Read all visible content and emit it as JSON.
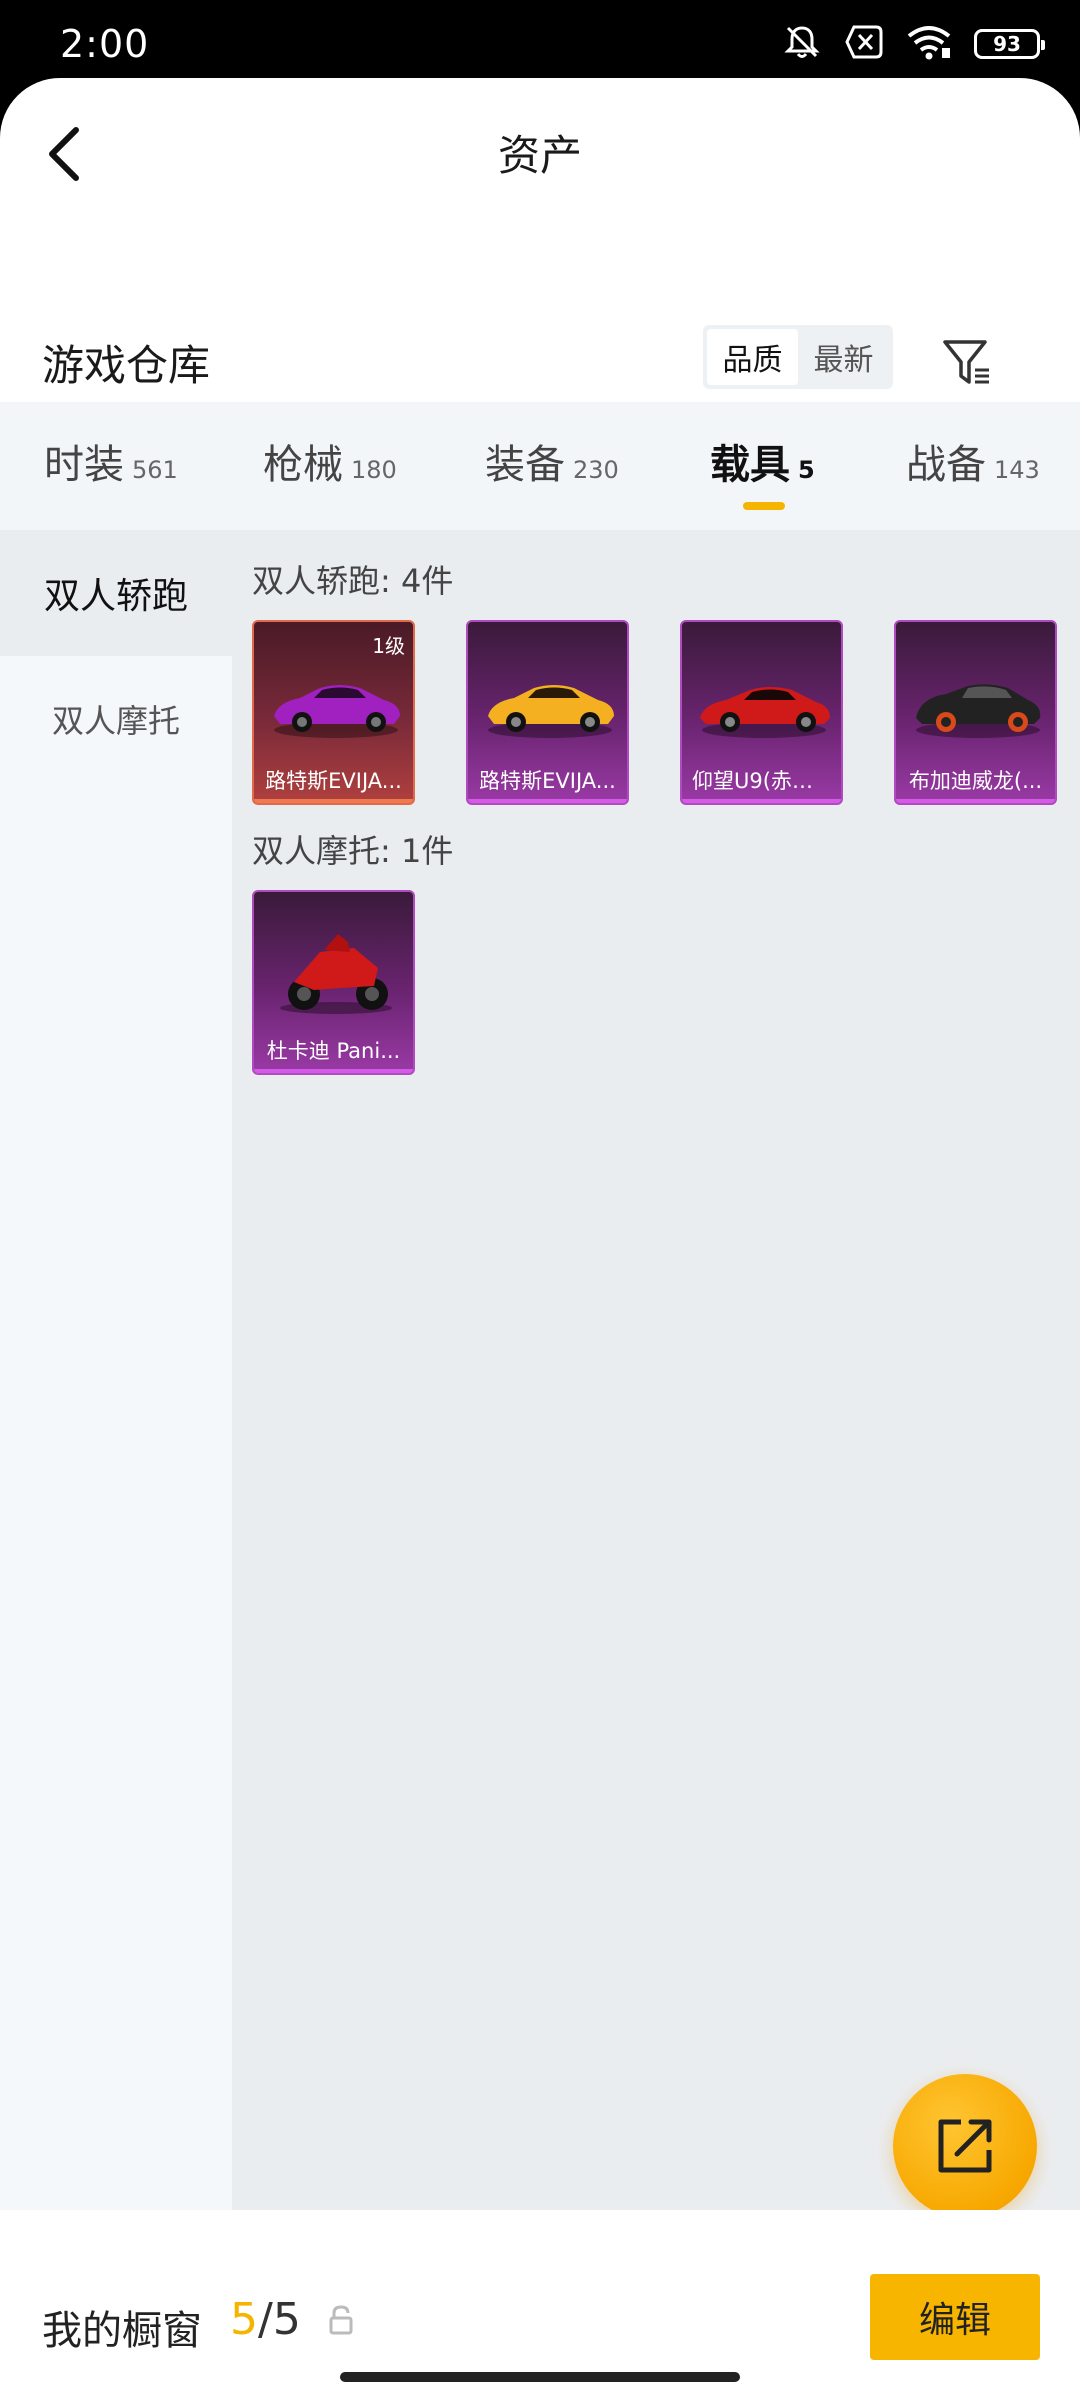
{
  "status_bar": {
    "time": "2:00",
    "battery": "93",
    "icons": [
      "mute-icon",
      "no-sim-icon",
      "wifi-icon",
      "battery-icon"
    ]
  },
  "header": {
    "title": "资产"
  },
  "warehouse": {
    "title": "游戏仓库",
    "sort_options": [
      "品质",
      "最新"
    ],
    "sort_selected": "品质"
  },
  "tabs": [
    {
      "label": "时装",
      "count": "561"
    },
    {
      "label": "枪械",
      "count": "180"
    },
    {
      "label": "装备",
      "count": "230"
    },
    {
      "label": "载具",
      "count": "5"
    },
    {
      "label": "战备",
      "count": "143"
    }
  ],
  "active_tab": "载具",
  "sidebar": {
    "items": [
      {
        "label": "双人轿跑"
      },
      {
        "label": "双人摩托"
      }
    ]
  },
  "groups": [
    {
      "title": "双人轿跑: 4件",
      "items": [
        {
          "name": "路特斯EVIJA...",
          "level": "1级",
          "quality": "legend",
          "color": "#a020c0"
        },
        {
          "name": "路特斯EVIJA...",
          "level": "",
          "quality": "epic",
          "color": "#f4b020"
        },
        {
          "name": "仰望U9(赤霞...",
          "level": "",
          "quality": "epic",
          "color": "#d01a1a"
        },
        {
          "name": "布加迪威龙(...",
          "level": "",
          "quality": "epic",
          "color": "#222222"
        }
      ]
    },
    {
      "title": "双人摩托: 1件",
      "items": [
        {
          "name": "杜卡迪 Pani...",
          "level": "",
          "quality": "epic",
          "color": "#d01a1a"
        }
      ]
    }
  ],
  "bottom": {
    "showcase_label": "我的橱窗",
    "showcase_current": "5",
    "showcase_total": "/5",
    "edit_label": "编辑"
  },
  "colors": {
    "accent": "#f5b400",
    "epic_border": "#b04ac0",
    "legend_border": "#e06a4a"
  }
}
